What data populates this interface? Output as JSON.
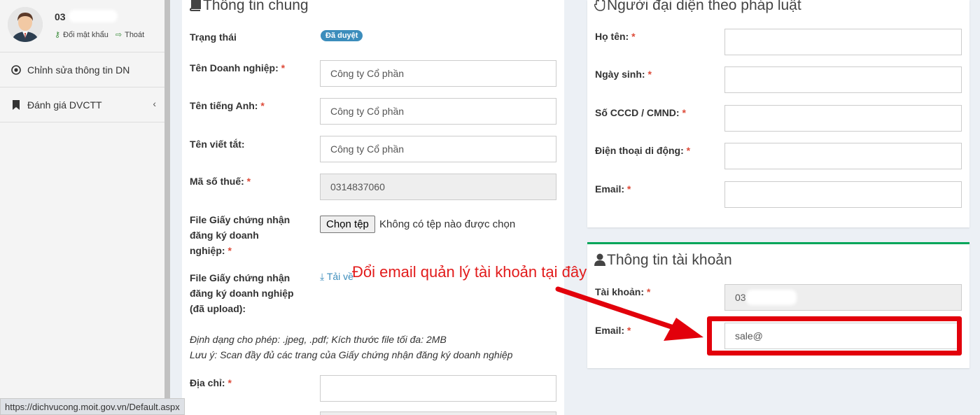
{
  "user": {
    "name": "03",
    "change_password": "Đổi mật khẩu",
    "logout": "Thoát"
  },
  "sidebar": {
    "items": [
      {
        "label": "Chỉnh sửa thông tin DN",
        "icon": "target-icon"
      },
      {
        "label": "Đánh giá DVCTT",
        "icon": "bookmark-icon"
      }
    ]
  },
  "general": {
    "title": "Thông tin chung",
    "status_label": "Trạng thái",
    "status_badge": "Đã duyệt",
    "company_name_label": "Tên Doanh nghiệp:",
    "company_name_value": "Công ty Cổ phần",
    "english_name_label": "Tên tiếng Anh:",
    "english_name_value": "Công ty Cổ phần",
    "short_name_label": "Tên viết tắt:",
    "short_name_value": "Công ty Cổ phần",
    "tax_code_label": "Mã số thuế:",
    "tax_code_value": "0314837060",
    "file_label_line1": "File Giấy chứng nhận",
    "file_label_line2": "đăng ký doanh",
    "file_label_line3": "nghiệp:",
    "file_button": "Chọn tệp",
    "file_status": "Không có tệp nào được chọn",
    "uploaded_label_line1": "File Giấy chứng nhận",
    "uploaded_label_line2": "đăng ký doanh nghiệp",
    "uploaded_label_line3": "(đã upload):",
    "download_link": "Tải về",
    "note_format": "Định dạng cho phép: .jpeg, .pdf; Kích thước file tối đa: 2MB",
    "note_scan": "Lưu ý: Scan đầy đủ các trang của Giấy chứng nhận đăng ký doanh nghiệp",
    "address_label": "Địa chỉ:"
  },
  "legal_rep": {
    "title": "Người đại diện theo pháp luật",
    "name_label": "Họ tên:",
    "dob_label": "Ngày sinh:",
    "id_label": "Số CCCD / CMND:",
    "phone_label": "Điện thoại di động:",
    "email_label": "Email:"
  },
  "account": {
    "title": "Thông tin tài khoản",
    "username_label": "Tài khoản:",
    "username_value": "03",
    "email_label": "Email:",
    "email_value": "sale@"
  },
  "annotation": {
    "text": "Đổi email quản lý tài khoản tại đây",
    "color": "#e21b1b"
  },
  "statusbar": {
    "url": "https://dichvucong.moit.gov.vn/Default.aspx"
  },
  "required_mark": "*"
}
